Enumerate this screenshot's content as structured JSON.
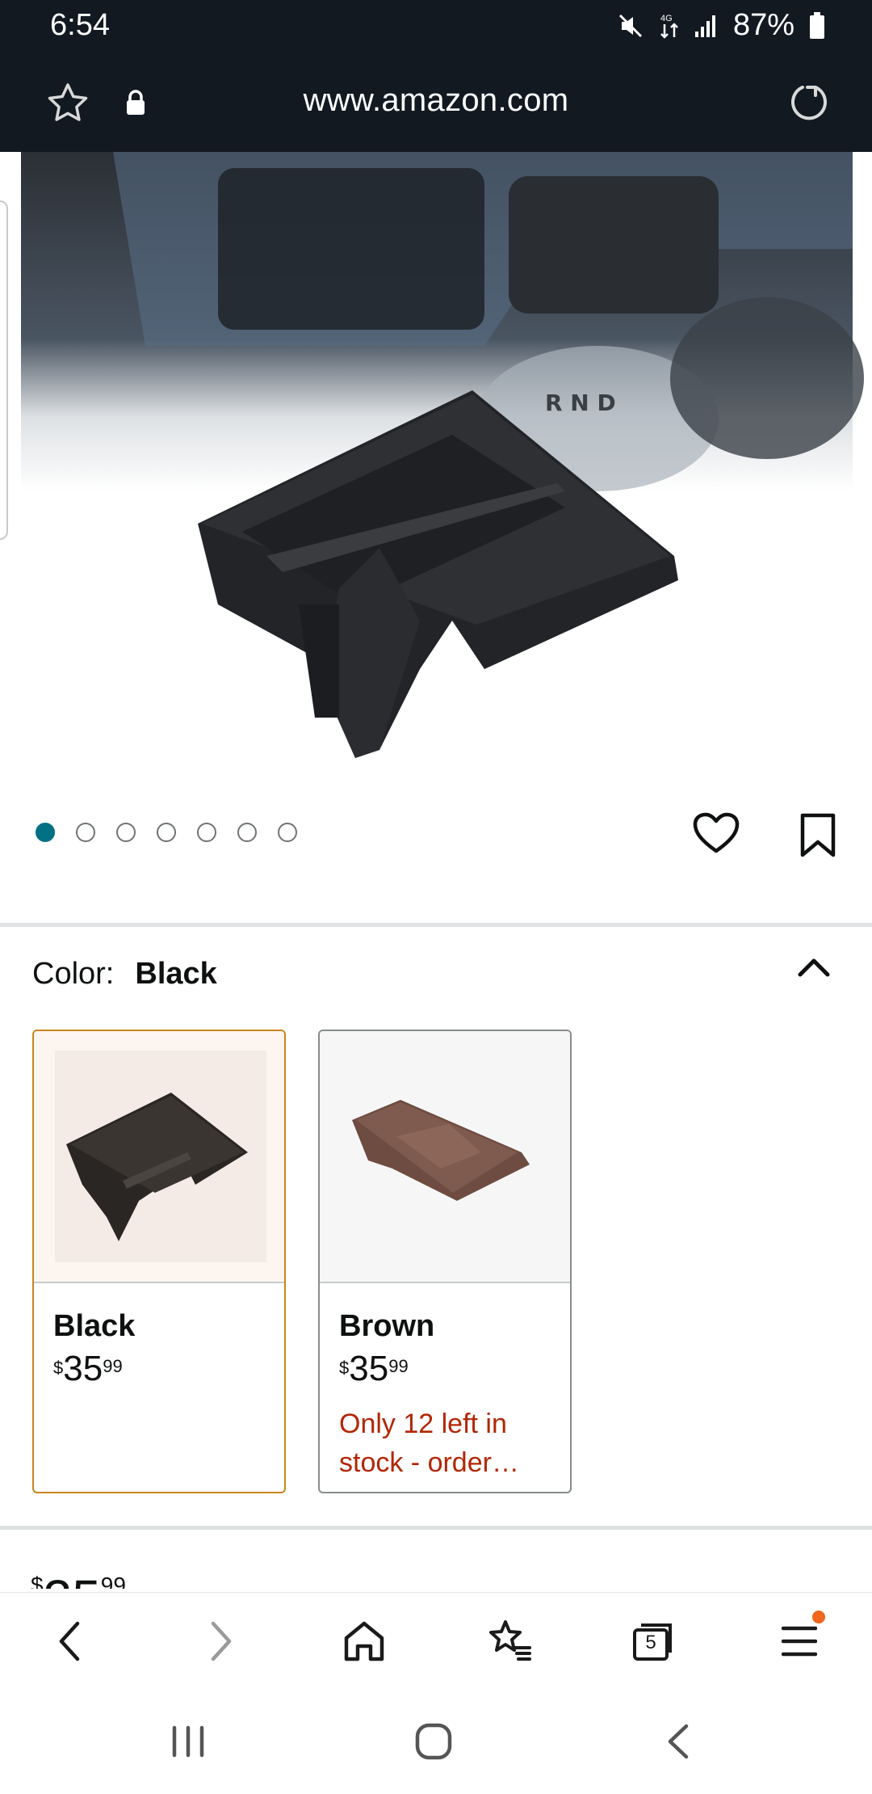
{
  "status_bar": {
    "time": "6:54",
    "battery": "87%",
    "icons": [
      "mute-icon",
      "data-transfer-icon",
      "signal-icon",
      "battery-icon"
    ]
  },
  "url_bar": {
    "url": "www.amazon.com",
    "icons": [
      "star-icon",
      "lock-icon",
      "reload-icon"
    ]
  },
  "product": {
    "image_count": 7,
    "active_image_index": 0,
    "icons": [
      "heart-icon",
      "bookmark-icon"
    ]
  },
  "color_selector": {
    "label": "Color:",
    "selected_value": "Black",
    "options": [
      {
        "name": "Black",
        "price": {
          "symbol": "$",
          "whole": "35",
          "fraction": "99"
        },
        "stock_note": "",
        "selected": true
      },
      {
        "name": "Brown",
        "price": {
          "symbol": "$",
          "whole": "35",
          "fraction": "99"
        },
        "stock_note": "Only 12 left in stock - order…",
        "selected": false
      }
    ]
  },
  "partial_price": {
    "symbol": "$",
    "whole": "35",
    "fraction": "99"
  },
  "browser_nav": {
    "tab_count": "5",
    "icons": [
      "back-icon",
      "forward-icon",
      "home-icon",
      "bookmarks-icon",
      "tabs-icon",
      "menu-icon"
    ]
  },
  "system_nav": {
    "icons": [
      "recent-apps-icon",
      "home-circle-icon",
      "system-back-icon"
    ]
  },
  "colors": {
    "header_bg": "#131921",
    "accent_teal": "#007185",
    "selected_border": "#c7851d",
    "stock_red": "#b12704",
    "notification": "#f0661a"
  }
}
